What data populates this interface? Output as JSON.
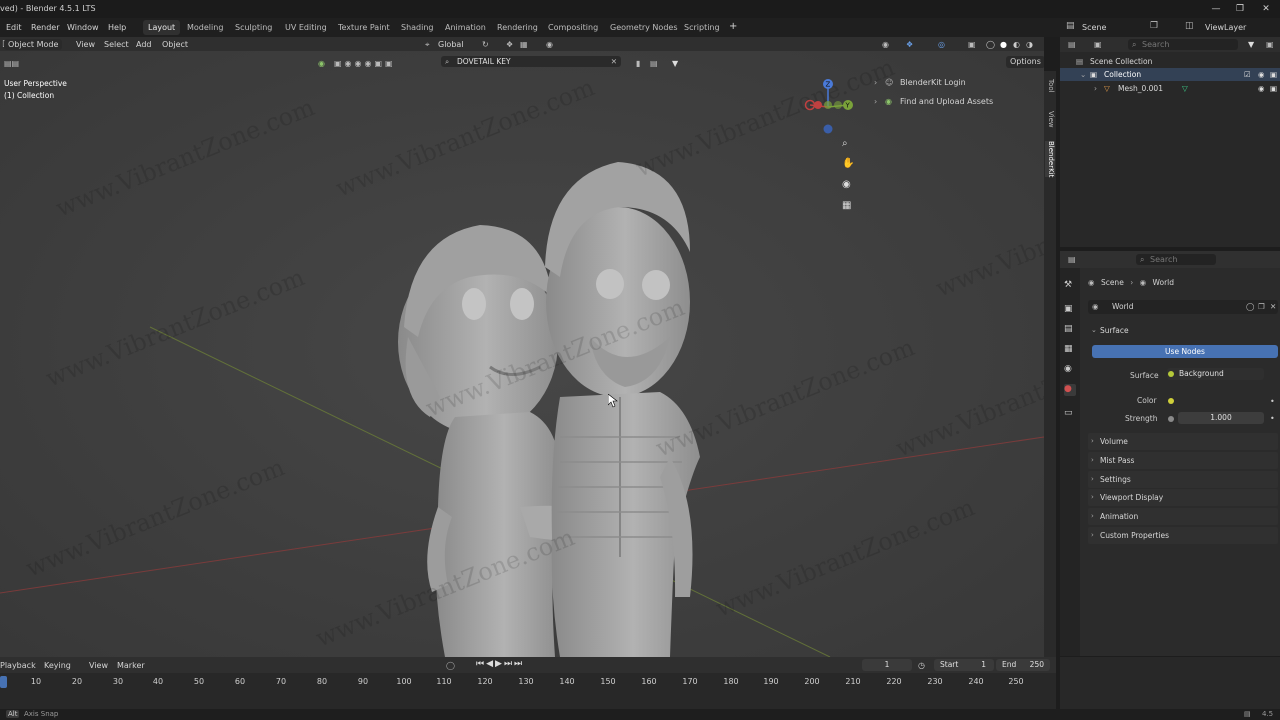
{
  "window": {
    "title": "ved) - Blender 4.5.1 LTS"
  },
  "menu": {
    "items": [
      "Edit",
      "Render",
      "Window",
      "Help"
    ]
  },
  "workspaces": [
    "Layout",
    "Modeling",
    "Sculpting",
    "UV Editing",
    "Texture Paint",
    "Shading",
    "Animation",
    "Rendering",
    "Compositing",
    "Geometry Nodes",
    "Scripting"
  ],
  "active_workspace": "Layout",
  "scene": {
    "name": "Scene",
    "view_layer": "ViewLayer"
  },
  "viewport_header": {
    "mode": "Object Mode",
    "menus": [
      "View",
      "Select",
      "Add",
      "Object"
    ],
    "orientation": "Global",
    "options": "Options"
  },
  "viewport": {
    "perspective": "User Perspective",
    "collection": "(1) Collection",
    "search_value": "DOVETAIL KEY",
    "addon_items": [
      "BlenderKit Login",
      "Find and Upload Assets"
    ],
    "side_tabs": [
      "Tool",
      "View",
      "BlenderKit"
    ],
    "gizmo_axes": [
      "Z",
      "Y",
      "X"
    ],
    "watermark": "www.VibrantZone.com"
  },
  "outliner": {
    "search_placeholder": "Search",
    "root": "Scene Collection",
    "collection": "Collection",
    "mesh": "Mesh_0.001"
  },
  "properties": {
    "search_placeholder": "Search",
    "breadcrumb": [
      "Scene",
      "World"
    ],
    "world_name": "World",
    "surface_label": "Surface",
    "use_nodes": "Use Nodes",
    "surface_field_label": "Surface",
    "surface_value": "Background",
    "color_label": "Color",
    "strength_label": "Strength",
    "strength_value": "1.000",
    "sections": [
      "Volume",
      "Mist Pass",
      "Settings",
      "Viewport Display",
      "Animation",
      "Custom Properties"
    ]
  },
  "timeline": {
    "menus": [
      "Playback",
      "Keying",
      "View",
      "Marker"
    ],
    "current_frame": "1",
    "start_label": "Start",
    "start": "1",
    "end_label": "End",
    "end": "250",
    "ruler": [
      "10",
      "20",
      "30",
      "40",
      "50",
      "60",
      "70",
      "80",
      "90",
      "100",
      "110",
      "120",
      "130",
      "140",
      "150",
      "160",
      "170",
      "180",
      "190",
      "200",
      "210",
      "220",
      "230",
      "240",
      "250"
    ]
  },
  "status": {
    "left": "Axis Snap",
    "version": "4.5"
  }
}
